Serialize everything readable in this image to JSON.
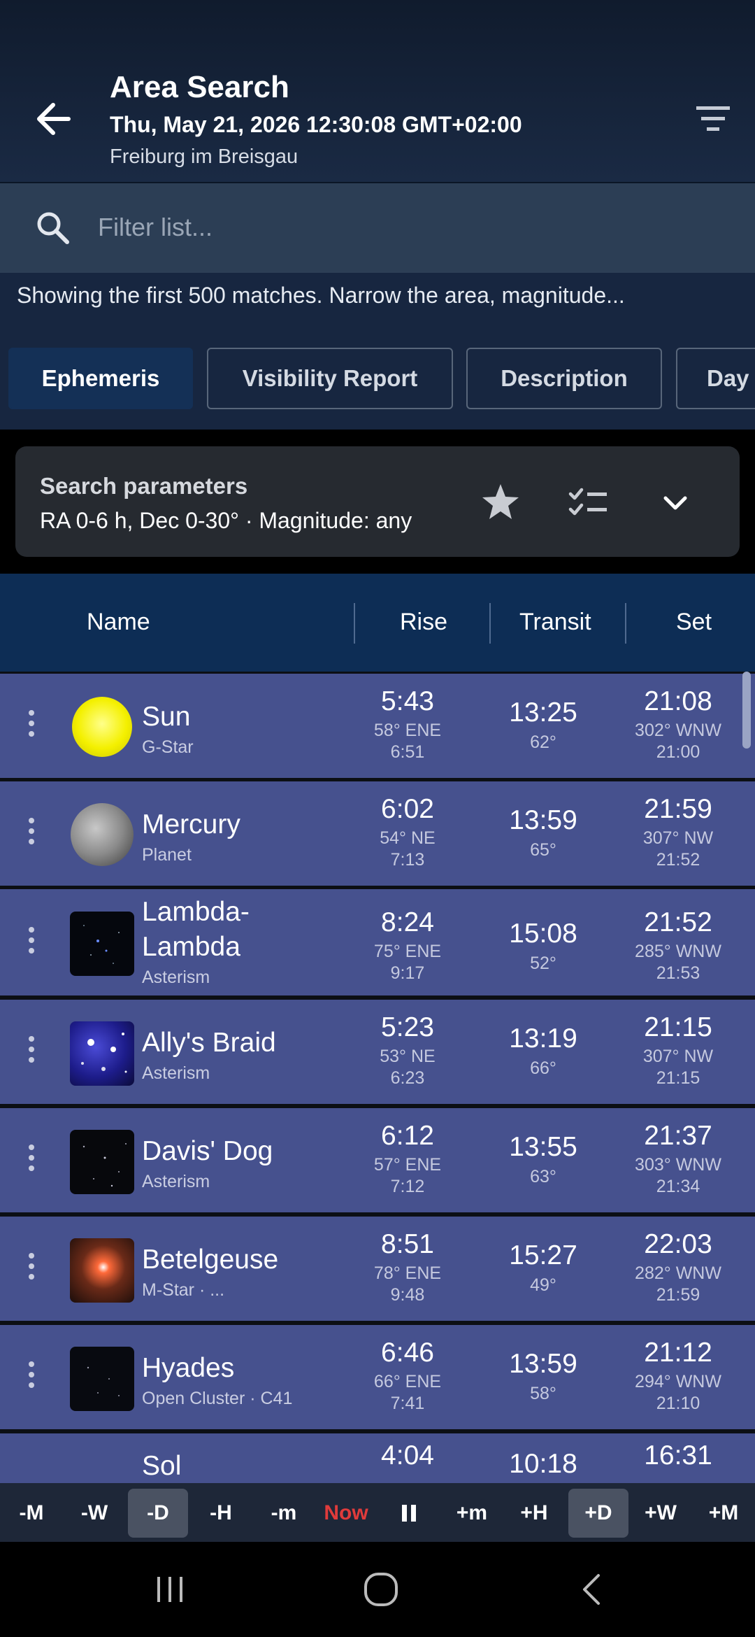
{
  "header": {
    "title": "Area Search",
    "datetime": "Thu, May 21, 2026 12:30:08 GMT+02:00",
    "location": "Freiburg im Breisgau"
  },
  "search": {
    "placeholder": "Filter list..."
  },
  "notice": "Showing the first 500 matches. Narrow the area, magnitude...",
  "tabs": [
    {
      "label": "Ephemeris",
      "active": true
    },
    {
      "label": "Visibility Report"
    },
    {
      "label": "Description"
    },
    {
      "label": "Day"
    }
  ],
  "params": {
    "title": "Search parameters",
    "desc": "RA 0-6 h, Dec 0-30° · Magnitude: any"
  },
  "columns": {
    "name": "Name",
    "rise": "Rise",
    "transit": "Transit",
    "set": "Set"
  },
  "rows": [
    {
      "name": "Sun",
      "type": "G-Star",
      "rise": "5:43",
      "rise_az": "58° ENE",
      "rise_2": "6:51",
      "transit": "13:25",
      "transit_alt": "62°",
      "set": "21:08",
      "set_az": "302° WNW",
      "set_2": "21:00",
      "thumb": "sun"
    },
    {
      "name": "Mercury",
      "type": "Planet",
      "rise": "6:02",
      "rise_az": "54° NE",
      "rise_2": "7:13",
      "transit": "13:59",
      "transit_alt": "65°",
      "set": "21:59",
      "set_az": "307° NW",
      "set_2": "21:52",
      "thumb": "mercury"
    },
    {
      "name": "Lambda-",
      "name2": "Lambda",
      "type": "Asterism",
      "rise": "8:24",
      "rise_az": "75° ENE",
      "rise_2": "9:17",
      "transit": "15:08",
      "transit_alt": "52°",
      "set": "21:52",
      "set_az": "285° WNW",
      "set_2": "21:53",
      "thumb": "lambda"
    },
    {
      "name": "Ally's Braid",
      "type": "Asterism",
      "rise": "5:23",
      "rise_az": "53° NE",
      "rise_2": "6:23",
      "transit": "13:19",
      "transit_alt": "66°",
      "set": "21:15",
      "set_az": "307° NW",
      "set_2": "21:15",
      "thumb": "braid"
    },
    {
      "name": "Davis' Dog",
      "type": "Asterism",
      "rise": "6:12",
      "rise_az": "57° ENE",
      "rise_2": "7:12",
      "transit": "13:55",
      "transit_alt": "63°",
      "set": "21:37",
      "set_az": "303° WNW",
      "set_2": "21:34",
      "thumb": "stars"
    },
    {
      "name": "Betelgeuse",
      "type": "M-Star · ...",
      "rise": "8:51",
      "rise_az": "78° ENE",
      "rise_2": "9:48",
      "transit": "15:27",
      "transit_alt": "49°",
      "set": "22:03",
      "set_az": "282° WNW",
      "set_2": "21:59",
      "thumb": "betelgeuse"
    },
    {
      "name": "Hyades",
      "type": "Open Cluster · C41",
      "rise": "6:46",
      "rise_az": "66° ENE",
      "rise_2": "7:41",
      "transit": "13:59",
      "transit_alt": "58°",
      "set": "21:12",
      "set_az": "294° WNW",
      "set_2": "21:10",
      "thumb": "hyades"
    },
    {
      "name": "Sol",
      "type": "",
      "rise": "4:04",
      "rise_az": "",
      "rise_2": "",
      "transit": "10:18",
      "transit_alt": "",
      "set": "16:31",
      "set_az": "",
      "set_2": "",
      "thumb": "stars"
    }
  ],
  "timebar": [
    "-M",
    "-W",
    "-D",
    "-H",
    "-m",
    "Now",
    "pause",
    "+m",
    "+H",
    "+D",
    "+W",
    "+M"
  ],
  "colors": {
    "row_bg": "#46518e",
    "accent_now": "#e03b3b",
    "header_bg": "#0d2d55"
  }
}
